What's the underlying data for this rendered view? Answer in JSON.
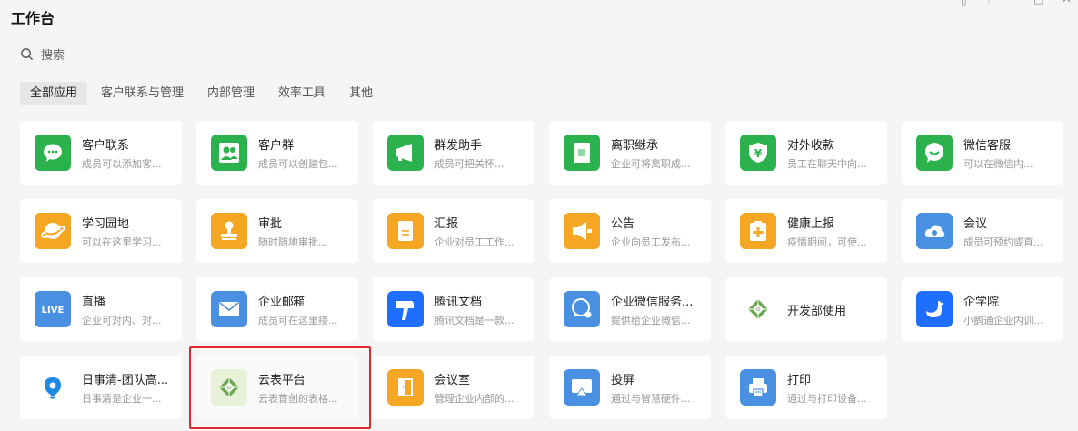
{
  "header": {
    "title": "工作台"
  },
  "search": {
    "placeholder": "搜索"
  },
  "tabs": [
    {
      "label": "全部应用",
      "active": true
    },
    {
      "label": "客户联系与管理",
      "active": false
    },
    {
      "label": "内部管理",
      "active": false
    },
    {
      "label": "效率工具",
      "active": false
    },
    {
      "label": "其他",
      "active": false
    }
  ],
  "apps": [
    {
      "name": "客户联系",
      "desc": "成员可以添加客...",
      "icon": "chat-bubble-icon",
      "color": "#2bb24c"
    },
    {
      "name": "客户群",
      "desc": "成员可以创建包...",
      "icon": "group-icon",
      "color": "#2bb24c"
    },
    {
      "name": "群发助手",
      "desc": "成员可把关怀...",
      "icon": "megaphone-icon",
      "color": "#2bb24c"
    },
    {
      "name": "离职继承",
      "desc": "企业可将离职成...",
      "icon": "document-icon",
      "color": "#2bb24c"
    },
    {
      "name": "对外收款",
      "desc": "员工在聊天中向...",
      "icon": "yuan-shield-icon",
      "color": "#2bb24c"
    },
    {
      "name": "微信客服",
      "desc": "可以在微信内...",
      "icon": "smile-chat-icon",
      "color": "#2bb24c"
    },
    {
      "name": "学习园地",
      "desc": "可以在这里学习...",
      "icon": "planet-icon",
      "color": "#f5a623"
    },
    {
      "name": "审批",
      "desc": "随时随地审批...",
      "icon": "stamp-icon",
      "color": "#f5a623"
    },
    {
      "name": "汇报",
      "desc": "企业对员工工作...",
      "icon": "report-icon",
      "color": "#f5a623"
    },
    {
      "name": "公告",
      "desc": "企业向员工发布...",
      "icon": "announce-icon",
      "color": "#f5a623"
    },
    {
      "name": "健康上报",
      "desc": "疫情期间，可使...",
      "icon": "health-icon",
      "color": "#f5a623"
    },
    {
      "name": "会议",
      "desc": "成员可预约或直...",
      "icon": "cloud-meeting-icon",
      "color": "#4a90e2"
    },
    {
      "name": "直播",
      "desc": "企业可对内、对...",
      "icon": "live-icon",
      "color": "#4a90e2",
      "badge": "LIVE"
    },
    {
      "name": "企业邮箱",
      "desc": "成员可在这里接...",
      "icon": "mail-icon",
      "color": "#4a90e2"
    },
    {
      "name": "腾讯文档",
      "desc": "腾讯文档是一款...",
      "icon": "tencent-docs-icon",
      "color": "#1e6fff"
    },
    {
      "name": "企业微信服务...",
      "desc": "提供给企业微信...",
      "icon": "service-chat-icon",
      "color": "#4a90e2"
    },
    {
      "name": "开发部使用",
      "desc": "",
      "icon": "diamond-logo-icon",
      "color": "#ffffff"
    },
    {
      "name": "企学院",
      "desc": "小鹅通企业内训...",
      "icon": "goose-icon",
      "color": "#1e6fff"
    },
    {
      "name": "日事清-团队高...",
      "desc": "日事清是企业一...",
      "icon": "location-pin-icon",
      "color": "#ffffff"
    },
    {
      "name": "云表平台",
      "desc": "云表首创的表格...",
      "icon": "diamond-logo-icon",
      "color": "#e8f0d8"
    },
    {
      "name": "会议室",
      "desc": "管理企业内部的...",
      "icon": "door-icon",
      "color": "#f5a623"
    },
    {
      "name": "投屏",
      "desc": "通过与智慧硬件...",
      "icon": "screen-cast-icon",
      "color": "#4a90e2"
    },
    {
      "name": "打印",
      "desc": "通过与打印设备...",
      "icon": "printer-icon",
      "color": "#4a90e2"
    }
  ]
}
